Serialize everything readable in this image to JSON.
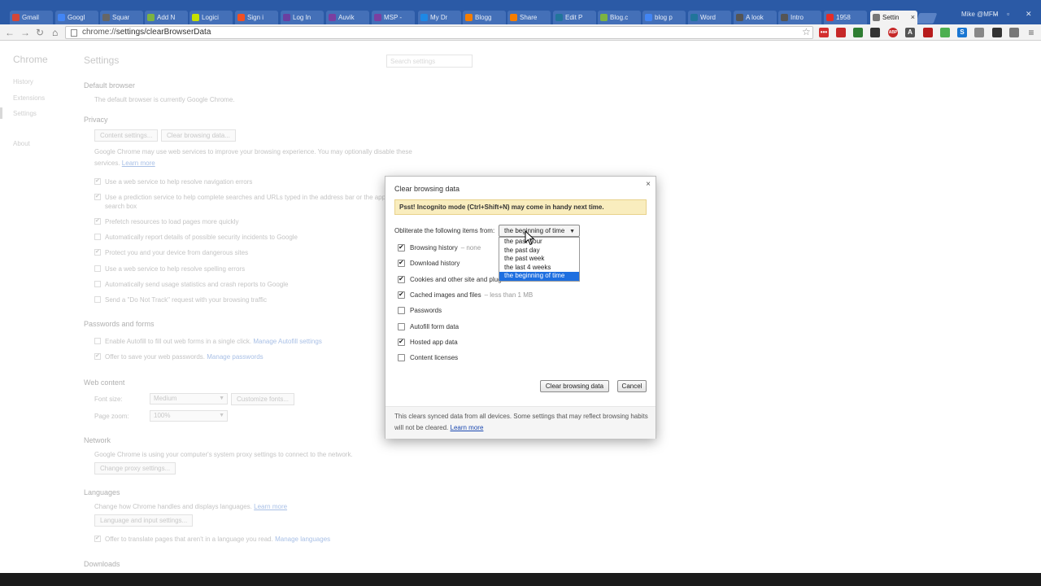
{
  "browser": {
    "tabs": [
      {
        "label": "Gmail",
        "color": "#d44638"
      },
      {
        "label": "Googl",
        "color": "#4285f4"
      },
      {
        "label": "Squar",
        "color": "#666666"
      },
      {
        "label": "Add N",
        "color": "#7cb342"
      },
      {
        "label": "Logici",
        "color": "#c5e000"
      },
      {
        "label": "Sign i",
        "color": "#f25022"
      },
      {
        "label": "Log In",
        "color": "#6a3fa0"
      },
      {
        "label": "Auvik",
        "color": "#7b3fa0"
      },
      {
        "label": "MSP -",
        "color": "#7b3fa0"
      },
      {
        "label": "My Dr",
        "color": "#1e88e5"
      },
      {
        "label": "Blogg",
        "color": "#f57d00"
      },
      {
        "label": "Share",
        "color": "#f57d00"
      },
      {
        "label": "Edit P",
        "color": "#21759b"
      },
      {
        "label": "Blog.c",
        "color": "#7cb342"
      },
      {
        "label": "blog p",
        "color": "#4285f4"
      },
      {
        "label": "Word",
        "color": "#21759b"
      },
      {
        "label": "A look",
        "color": "#555555"
      },
      {
        "label": "Intro",
        "color": "#555555"
      },
      {
        "label": "1958",
        "color": "#e52d27"
      },
      {
        "label": "Settin",
        "color": "#777777",
        "active": true
      }
    ],
    "profile": "Mike @MFM",
    "url_scheme": "chrome://",
    "url_path": "settings/clearBrowserData",
    "extensions": [
      {
        "name": "lastpass-icon",
        "glyph": "•••",
        "color": "#d32f2f"
      },
      {
        "name": "red-square-icon",
        "glyph": "",
        "color": "#c62828"
      },
      {
        "name": "green-circle-icon",
        "glyph": "",
        "color": "#2e7d32"
      },
      {
        "name": "calculator-icon",
        "glyph": "",
        "color": "#333333"
      },
      {
        "name": "adblock-plus-icon",
        "glyph": "ABP",
        "color": "#c62828"
      },
      {
        "name": "font-icon",
        "glyph": "A",
        "color": "#555555"
      },
      {
        "name": "record-icon",
        "glyph": "",
        "color": "#b71c1c"
      },
      {
        "name": "chrome-icon",
        "glyph": "",
        "color": "#4caf50"
      },
      {
        "name": "s-icon",
        "glyph": "S",
        "color": "#1976d2"
      },
      {
        "name": "rss-icon",
        "glyph": "",
        "color": "#888888"
      },
      {
        "name": "glasses-icon",
        "glyph": "",
        "color": "#333333"
      },
      {
        "name": "extension-icon",
        "glyph": "",
        "color": "#777777"
      },
      {
        "name": "menu-icon",
        "glyph": "≡",
        "color": "#666666"
      }
    ]
  },
  "settings": {
    "nav_title": "Chrome",
    "nav_items": [
      "History",
      "Extensions",
      "Settings",
      "About"
    ],
    "title": "Settings",
    "search_placeholder": "Search settings",
    "default_browser_head": "Default browser",
    "default_browser_text": "The default browser is currently Google Chrome.",
    "privacy_head": "Privacy",
    "content_settings_btn": "Content settings...",
    "clear_data_btn": "Clear browsing data...",
    "privacy_text_1": "Google Chrome may use web services to improve your browsing experience. You may optionally disable these",
    "privacy_text_2": "services.",
    "learn_more": "Learn more",
    "privacy_options": [
      {
        "label": "Use a web service to help resolve navigation errors",
        "checked": true
      },
      {
        "label": "Use a prediction service to help complete searches and URLs typed in the address bar or the app la",
        "checked": true
      },
      {
        "label": "search box",
        "checked": null
      },
      {
        "label": "Prefetch resources to load pages more quickly",
        "checked": true
      },
      {
        "label": "Automatically report details of possible security incidents to Google",
        "checked": false
      },
      {
        "label": "Protect you and your device from dangerous sites",
        "checked": true
      },
      {
        "label": "Use a web service to help resolve spelling errors",
        "checked": false
      },
      {
        "label": "Automatically send usage statistics and crash reports to Google",
        "checked": false
      },
      {
        "label": "Send a \"Do Not Track\" request with your browsing traffic",
        "checked": false
      }
    ],
    "passwords_head": "Passwords and forms",
    "autofill_text": "Enable Autofill to fill out web forms in a single click.",
    "manage_autofill": "Manage Autofill settings",
    "save_pw_text": "Offer to save your web passwords.",
    "manage_passwords": "Manage passwords",
    "web_content_head": "Web content",
    "font_size_label": "Font size:",
    "font_size_value": "Medium",
    "customize_fonts_btn": "Customize fonts...",
    "page_zoom_label": "Page zoom:",
    "page_zoom_value": "100%",
    "network_head": "Network",
    "network_text": "Google Chrome is using your computer's system proxy settings to connect to the network.",
    "proxy_btn": "Change proxy settings...",
    "languages_head": "Languages",
    "languages_text": "Change how Chrome handles and displays languages.",
    "language_btn": "Language and input settings...",
    "translate_text": "Offer to translate pages that aren't in a language you read.",
    "manage_languages": "Manage languages",
    "downloads_head": "Downloads"
  },
  "dialog": {
    "title": "Clear browsing data",
    "close": "×",
    "banner": "Psst! Incognito mode (Ctrl+Shift+N) may come in handy next time.",
    "range_label": "Obliterate the following items from:",
    "range_value": "the beginning of time",
    "range_options": [
      "the past hour",
      "the past day",
      "the past week",
      "the last 4 weeks",
      "the beginning of time"
    ],
    "items": [
      {
        "label": "Browsing history",
        "meta": "– none",
        "checked": true
      },
      {
        "label": "Download history",
        "meta": "",
        "checked": true
      },
      {
        "label": "Cookies and other site and plug",
        "meta": "",
        "checked": true
      },
      {
        "label": "Cached images and files",
        "meta": "– less than 1 MB",
        "checked": true
      },
      {
        "label": "Passwords",
        "meta": "",
        "checked": false
      },
      {
        "label": "Autofill form data",
        "meta": "",
        "checked": false
      },
      {
        "label": "Hosted app data",
        "meta": "",
        "checked": true
      },
      {
        "label": "Content licenses",
        "meta": "",
        "checked": false
      }
    ],
    "clear_button": "Clear browsing data",
    "cancel_button": "Cancel",
    "footer_text": "This clears synced data from all devices. Some settings that may reflect browsing habits will not be cleared.",
    "footer_link": "Learn more"
  }
}
